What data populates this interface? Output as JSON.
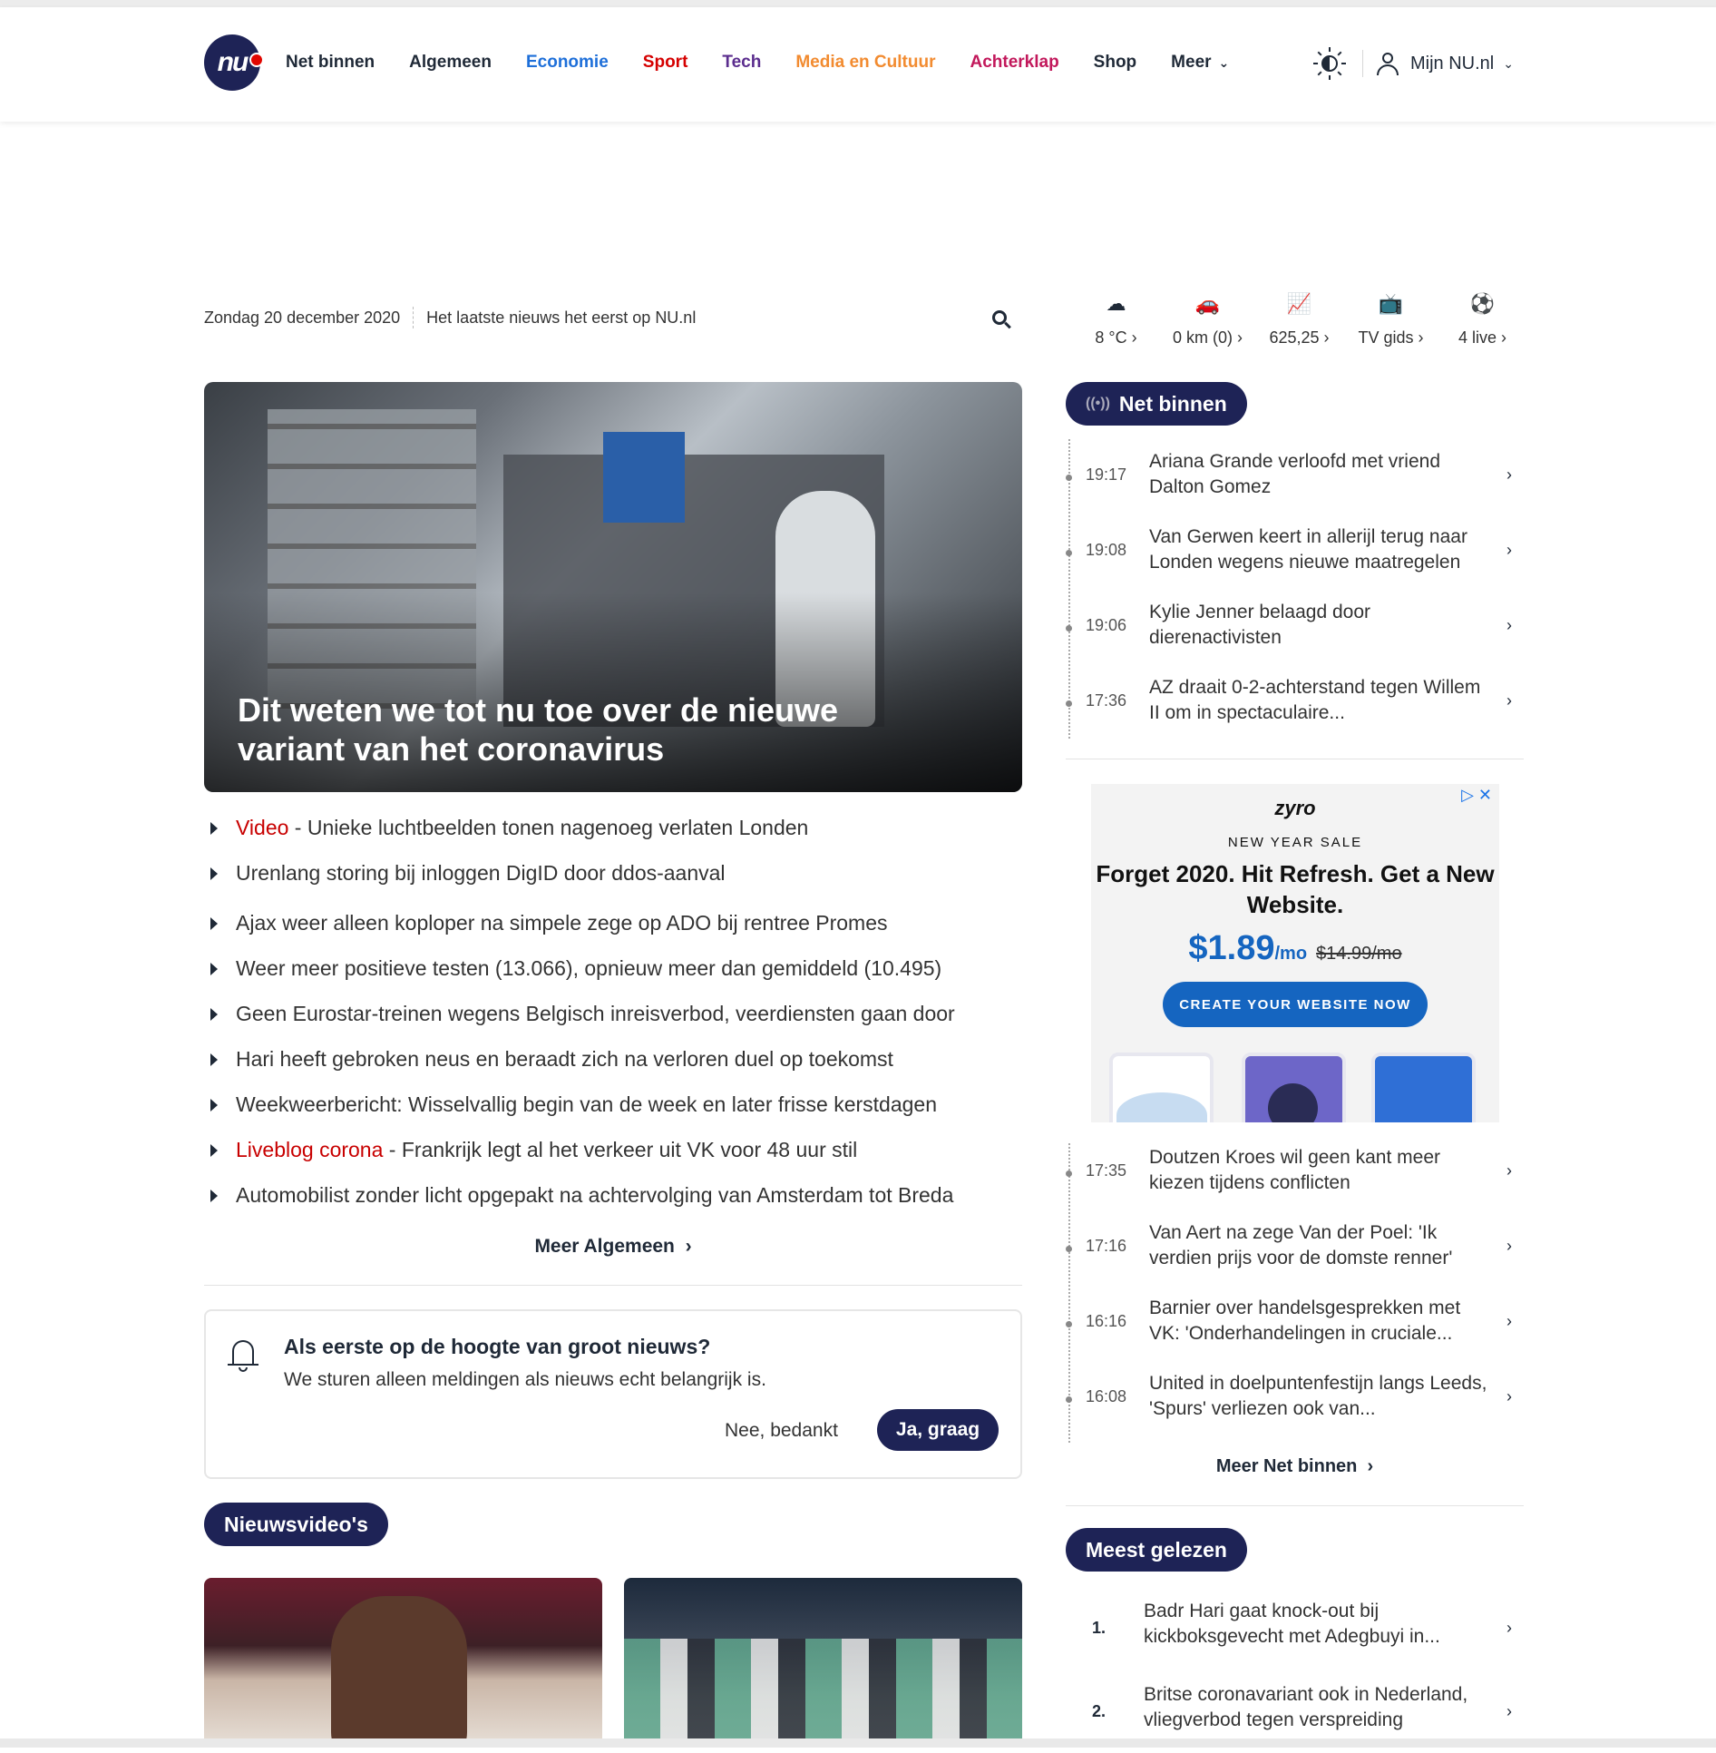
{
  "header": {
    "logo_text": "nu",
    "nav": [
      {
        "label": "Net binnen",
        "color": "#1f2937"
      },
      {
        "label": "Algemeen",
        "color": "#1f2937"
      },
      {
        "label": "Economie",
        "color": "#1e6fd9"
      },
      {
        "label": "Sport",
        "color": "#d50000"
      },
      {
        "label": "Tech",
        "color": "#5b2d8e"
      },
      {
        "label": "Media en Cultuur",
        "color": "#f28b30"
      },
      {
        "label": "Achterklap",
        "color": "#c2185b"
      },
      {
        "label": "Shop",
        "color": "#1f2937"
      },
      {
        "label": "Meer",
        "color": "#1f2937"
      }
    ],
    "account_label": "Mijn NU.nl"
  },
  "daterow": {
    "date": "Zondag 20 december 2020",
    "tagline": "Het laatste nieuws het eerst op NU.nl"
  },
  "widgets": [
    {
      "icon": "weather-icon",
      "glyph": "☁",
      "label": "8 °C"
    },
    {
      "icon": "traffic-icon",
      "glyph": "🚗",
      "label": "0 km (0)"
    },
    {
      "icon": "stocks-icon",
      "glyph": "📈",
      "label": "625,25"
    },
    {
      "icon": "tv-icon",
      "glyph": "📺",
      "label": "TV gids"
    },
    {
      "icon": "live-icon",
      "glyph": "⚽",
      "label": "4 live"
    }
  ],
  "hero": {
    "title": "Dit weten we tot nu toe over de nieuwe variant van het coronavirus"
  },
  "news": [
    {
      "label": "Video",
      "text": "Unieke luchtbeelden tonen nagenoeg verlaten Londen"
    },
    {
      "label": "",
      "text": "Urenlang storing bij inloggen DigID door ddos-aanval"
    },
    {
      "label": "",
      "text": "Ajax weer alleen koploper na simpele zege op ADO bij rentree Promes"
    },
    {
      "label": "",
      "text": "Weer meer positieve testen (13.066), opnieuw meer dan gemiddeld (10.495)"
    },
    {
      "label": "",
      "text": "Geen Eurostar-treinen wegens Belgisch inreisverbod, veerdiensten gaan door"
    },
    {
      "label": "",
      "text": "Hari heeft gebroken neus en beraadt zich na verloren duel op toekomst"
    },
    {
      "label": "",
      "text": "Weekweerbericht: Wisselvallig begin van de week en later frisse kerstdagen"
    },
    {
      "label": "Liveblog corona",
      "text": "Frankrijk legt al het verkeer uit VK voor 48 uur stil"
    },
    {
      "label": "",
      "text": "Automobilist zonder licht opgepakt na achtervolging van Amsterdam tot Breda"
    }
  ],
  "label_sep": " - ",
  "meer_algemeen": "Meer Algemeen",
  "notify": {
    "title": "Als eerste op de hoogte van groot nieuws?",
    "text": "We sturen alleen meldingen als nieuws echt belangrijk is.",
    "decline": "Nee, bedankt",
    "accept": "Ja, graag"
  },
  "nieuwsvideos_title": "Nieuwsvideo's",
  "net_binnen": {
    "title": "Net binnen",
    "items_top": [
      {
        "time": "19:17",
        "title": "Ariana Grande verloofd met vriend Dalton Gomez"
      },
      {
        "time": "19:08",
        "title": "Van Gerwen keert in allerijl terug naar Londen wegens nieuwe maatregelen"
      },
      {
        "time": "19:06",
        "title": "Kylie Jenner belaagd door dierenactivisten"
      },
      {
        "time": "17:36",
        "title": "AZ draait 0-2-achterstand tegen Willem II om in spectaculaire..."
      }
    ],
    "items_bottom": [
      {
        "time": "17:35",
        "title": "Doutzen Kroes wil geen kant meer kiezen tijdens conflicten"
      },
      {
        "time": "17:16",
        "title": "Van Aert na zege Van der Poel: 'Ik verdien prijs voor de domste renner'"
      },
      {
        "time": "16:16",
        "title": "Barnier over handelsgesprekken met VK: 'Onderhandelingen in cruciale..."
      },
      {
        "time": "16:08",
        "title": "United in doelpuntenfestijn langs Leeds, 'Spurs' verliezen ook van..."
      }
    ],
    "more": "Meer Net binnen"
  },
  "ad": {
    "brand": "zyro",
    "sale": "NEW YEAR SALE",
    "headline": "Forget 2020. Hit Refresh. Get a New Website.",
    "price": "$1.89",
    "per": "/mo",
    "old_price": "$14.99/mo",
    "cta": "CREATE YOUR WEBSITE NOW"
  },
  "meest_gelezen": {
    "title": "Meest gelezen",
    "items": [
      {
        "num": "1.",
        "title": "Badr Hari gaat knock-out bij kickboksgevecht met Adegbuyi in..."
      },
      {
        "num": "2.",
        "title": "Britse coronavariant ook in Nederland, vliegverbod tegen verspreiding"
      }
    ]
  }
}
